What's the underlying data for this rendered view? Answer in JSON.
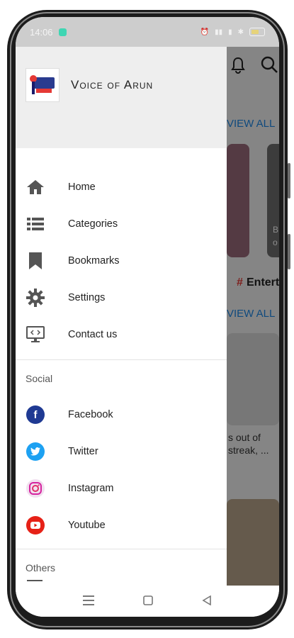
{
  "status_bar": {
    "time": "14:06"
  },
  "app": {
    "title": "Voice of Arun",
    "view_all_1": "VIEW ALL",
    "view_all_2": "VIEW ALL",
    "category_hash": "#",
    "category_partial": "Entert",
    "card_side_text": "B\no",
    "article_snippet_line1": "s out of",
    "article_snippet_line2": "streak, ..."
  },
  "drawer": {
    "menu": [
      {
        "label": "Home",
        "icon": "home-icon"
      },
      {
        "label": "Categories",
        "icon": "list-icon"
      },
      {
        "label": "Bookmarks",
        "icon": "bookmark-icon"
      },
      {
        "label": "Settings",
        "icon": "gear-icon"
      },
      {
        "label": "Contact us",
        "icon": "monitor-code-icon"
      }
    ],
    "social_title": "Social",
    "social": [
      {
        "label": "Facebook",
        "icon": "facebook-icon",
        "color": "#1f3a93"
      },
      {
        "label": "Twitter",
        "icon": "twitter-icon",
        "color": "#1da1f2"
      },
      {
        "label": "Instagram",
        "icon": "instagram-icon",
        "color": "#e1306c"
      },
      {
        "label": "Youtube",
        "icon": "youtube-icon",
        "color": "#e62117"
      }
    ],
    "others_title": "Others"
  },
  "colors": {
    "accent": "#1e88e5",
    "drawer_header": "#eeeeee"
  }
}
